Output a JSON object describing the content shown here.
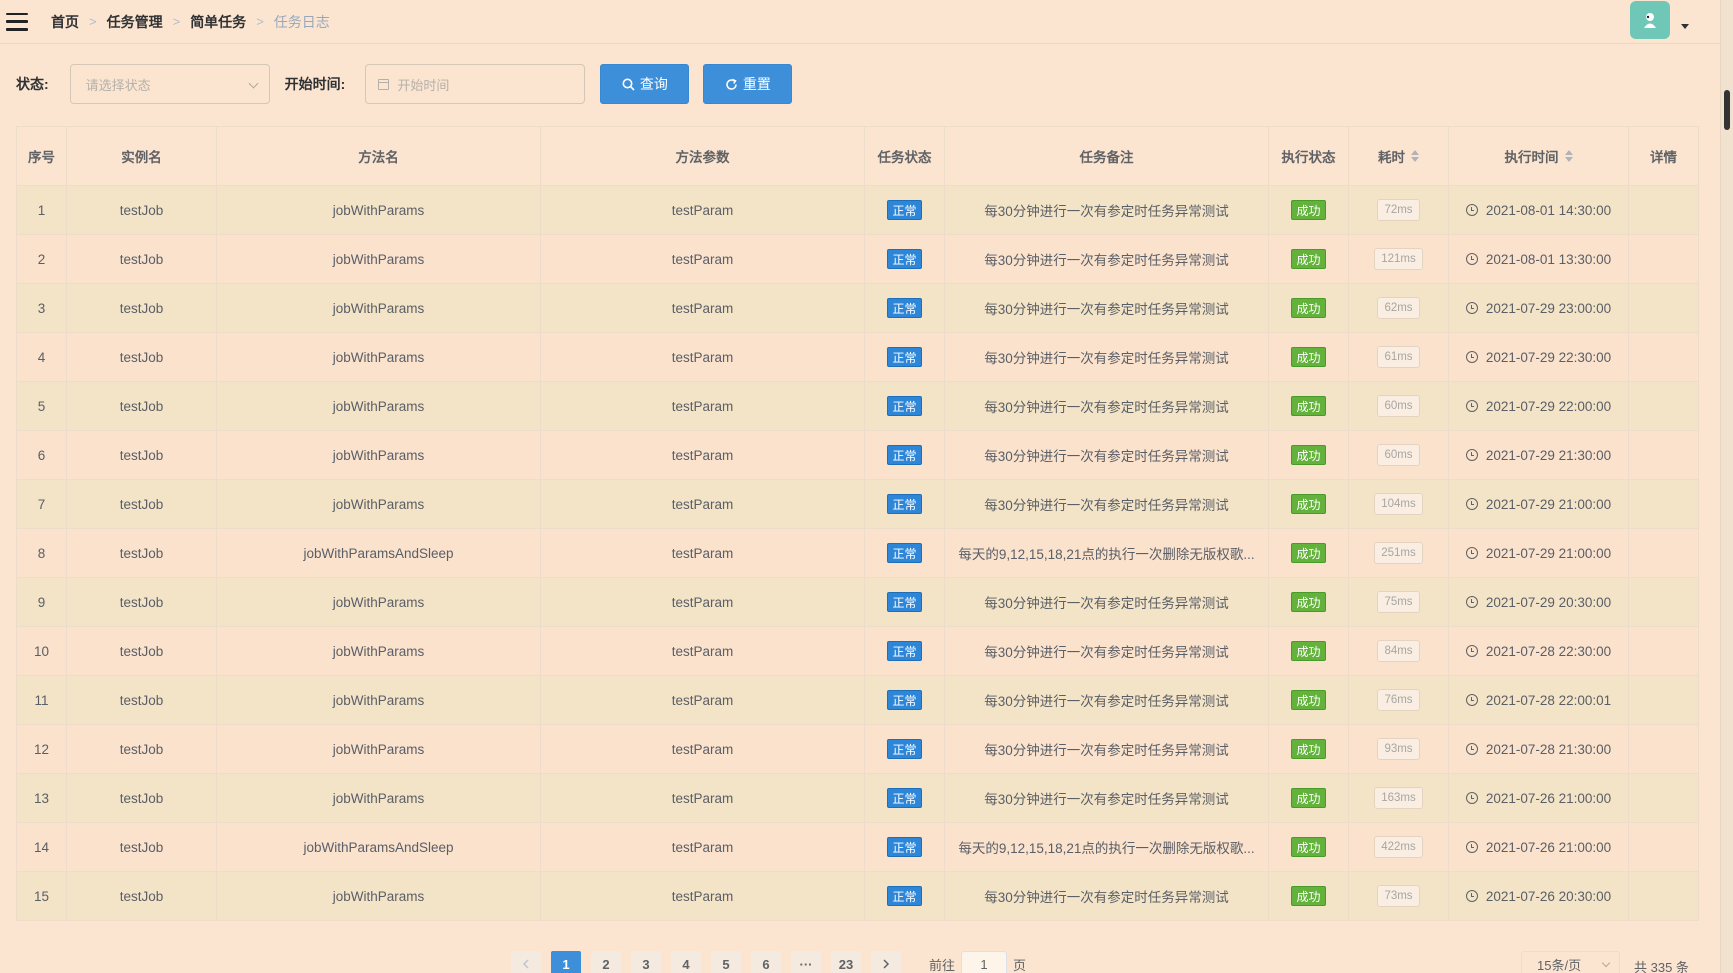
{
  "breadcrumb": [
    "首页",
    "任务管理",
    "简单任务",
    "任务日志"
  ],
  "filters": {
    "status_label": "状态:",
    "status_placeholder": "请选择状态",
    "start_label": "开始时间:",
    "start_placeholder": "开始时间",
    "query_label": "查询",
    "reset_label": "重置"
  },
  "table": {
    "headers": [
      "序号",
      "实例名",
      "方法名",
      "方法参数",
      "任务状态",
      "任务备注",
      "执行状态",
      "耗时",
      "执行时间",
      "详情"
    ],
    "rows": [
      {
        "no": "1",
        "instance": "testJob",
        "method": "jobWithParams",
        "params": "testParam",
        "task_status": "正常",
        "remark": "每30分钟进行一次有参定时任务异常测试",
        "exec_status": "成功",
        "cost": "72ms",
        "time": "2021-08-01 14:30:00"
      },
      {
        "no": "2",
        "instance": "testJob",
        "method": "jobWithParams",
        "params": "testParam",
        "task_status": "正常",
        "remark": "每30分钟进行一次有参定时任务异常测试",
        "exec_status": "成功",
        "cost": "121ms",
        "time": "2021-08-01 13:30:00"
      },
      {
        "no": "3",
        "instance": "testJob",
        "method": "jobWithParams",
        "params": "testParam",
        "task_status": "正常",
        "remark": "每30分钟进行一次有参定时任务异常测试",
        "exec_status": "成功",
        "cost": "62ms",
        "time": "2021-07-29 23:00:00"
      },
      {
        "no": "4",
        "instance": "testJob",
        "method": "jobWithParams",
        "params": "testParam",
        "task_status": "正常",
        "remark": "每30分钟进行一次有参定时任务异常测试",
        "exec_status": "成功",
        "cost": "61ms",
        "time": "2021-07-29 22:30:00"
      },
      {
        "no": "5",
        "instance": "testJob",
        "method": "jobWithParams",
        "params": "testParam",
        "task_status": "正常",
        "remark": "每30分钟进行一次有参定时任务异常测试",
        "exec_status": "成功",
        "cost": "60ms",
        "time": "2021-07-29 22:00:00"
      },
      {
        "no": "6",
        "instance": "testJob",
        "method": "jobWithParams",
        "params": "testParam",
        "task_status": "正常",
        "remark": "每30分钟进行一次有参定时任务异常测试",
        "exec_status": "成功",
        "cost": "60ms",
        "time": "2021-07-29 21:30:00"
      },
      {
        "no": "7",
        "instance": "testJob",
        "method": "jobWithParams",
        "params": "testParam",
        "task_status": "正常",
        "remark": "每30分钟进行一次有参定时任务异常测试",
        "exec_status": "成功",
        "cost": "104ms",
        "time": "2021-07-29 21:00:00"
      },
      {
        "no": "8",
        "instance": "testJob",
        "method": "jobWithParamsAndSleep",
        "params": "testParam",
        "task_status": "正常",
        "remark": "每天的9,12,15,18,21点的执行一次删除无版权歌...",
        "exec_status": "成功",
        "cost": "251ms",
        "time": "2021-07-29 21:00:00"
      },
      {
        "no": "9",
        "instance": "testJob",
        "method": "jobWithParams",
        "params": "testParam",
        "task_status": "正常",
        "remark": "每30分钟进行一次有参定时任务异常测试",
        "exec_status": "成功",
        "cost": "75ms",
        "time": "2021-07-29 20:30:00"
      },
      {
        "no": "10",
        "instance": "testJob",
        "method": "jobWithParams",
        "params": "testParam",
        "task_status": "正常",
        "remark": "每30分钟进行一次有参定时任务异常测试",
        "exec_status": "成功",
        "cost": "84ms",
        "time": "2021-07-28 22:30:00"
      },
      {
        "no": "11",
        "instance": "testJob",
        "method": "jobWithParams",
        "params": "testParam",
        "task_status": "正常",
        "remark": "每30分钟进行一次有参定时任务异常测试",
        "exec_status": "成功",
        "cost": "76ms",
        "time": "2021-07-28 22:00:01"
      },
      {
        "no": "12",
        "instance": "testJob",
        "method": "jobWithParams",
        "params": "testParam",
        "task_status": "正常",
        "remark": "每30分钟进行一次有参定时任务异常测试",
        "exec_status": "成功",
        "cost": "93ms",
        "time": "2021-07-28 21:30:00"
      },
      {
        "no": "13",
        "instance": "testJob",
        "method": "jobWithParams",
        "params": "testParam",
        "task_status": "正常",
        "remark": "每30分钟进行一次有参定时任务异常测试",
        "exec_status": "成功",
        "cost": "163ms",
        "time": "2021-07-26 21:00:00"
      },
      {
        "no": "14",
        "instance": "testJob",
        "method": "jobWithParamsAndSleep",
        "params": "testParam",
        "task_status": "正常",
        "remark": "每天的9,12,15,18,21点的执行一次删除无版权歌...",
        "exec_status": "成功",
        "cost": "422ms",
        "time": "2021-07-26 21:00:00"
      },
      {
        "no": "15",
        "instance": "testJob",
        "method": "jobWithParams",
        "params": "testParam",
        "task_status": "正常",
        "remark": "每30分钟进行一次有参定时任务异常测试",
        "exec_status": "成功",
        "cost": "73ms",
        "time": "2021-07-26 20:30:00"
      }
    ]
  },
  "pagination": {
    "pages": [
      "1",
      "2",
      "3",
      "4",
      "5",
      "6",
      "···",
      "23"
    ],
    "current": "1",
    "goto_prefix": "前往",
    "goto_value": "1",
    "goto_suffix": "页",
    "page_size": "15条/页",
    "total": "共 335 条"
  },
  "colors": {
    "background": "#fbe5d0",
    "primary": "#3d8fd9",
    "success": "#62b23b",
    "avatar": "#6fc7b7"
  },
  "icons": {
    "menu": "hamburger-icon",
    "search": "search-icon",
    "reset": "refresh-icon",
    "calendar": "calendar-icon",
    "clock": "clock-icon"
  }
}
